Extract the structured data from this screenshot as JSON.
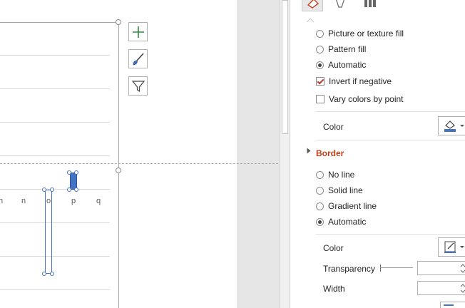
{
  "chart": {
    "x_ticks": [
      "n",
      "o",
      "p",
      "q"
    ],
    "x_tick_partial": "h"
  },
  "chart_side_buttons": {
    "elements": "chart-elements",
    "styles": "chart-styles",
    "filters": "chart-filters"
  },
  "pane": {
    "tabs": [
      "fill-line-icon",
      "effects-icon",
      "series-options-icon"
    ],
    "fill_options": {
      "picture_texture": "Picture or texture fill",
      "pattern": "Pattern fill",
      "automatic": "Automatic",
      "invert_if_negative": "Invert if negative",
      "vary_colors": "Vary colors by point",
      "selected": "automatic",
      "invert_checked": true,
      "vary_checked": false
    },
    "fill_color_label": "Color",
    "border": {
      "title": "Border",
      "no_line": "No line",
      "solid_line": "Solid line",
      "gradient_line": "Gradient line",
      "automatic": "Automatic",
      "selected": "automatic",
      "color_label": "Color",
      "transparency_label": "Transparency",
      "width_label": "Width"
    }
  },
  "colors": {
    "accent": "#c43e1c",
    "series": "#4472c4",
    "elements_plus": "#2e8b3e"
  }
}
